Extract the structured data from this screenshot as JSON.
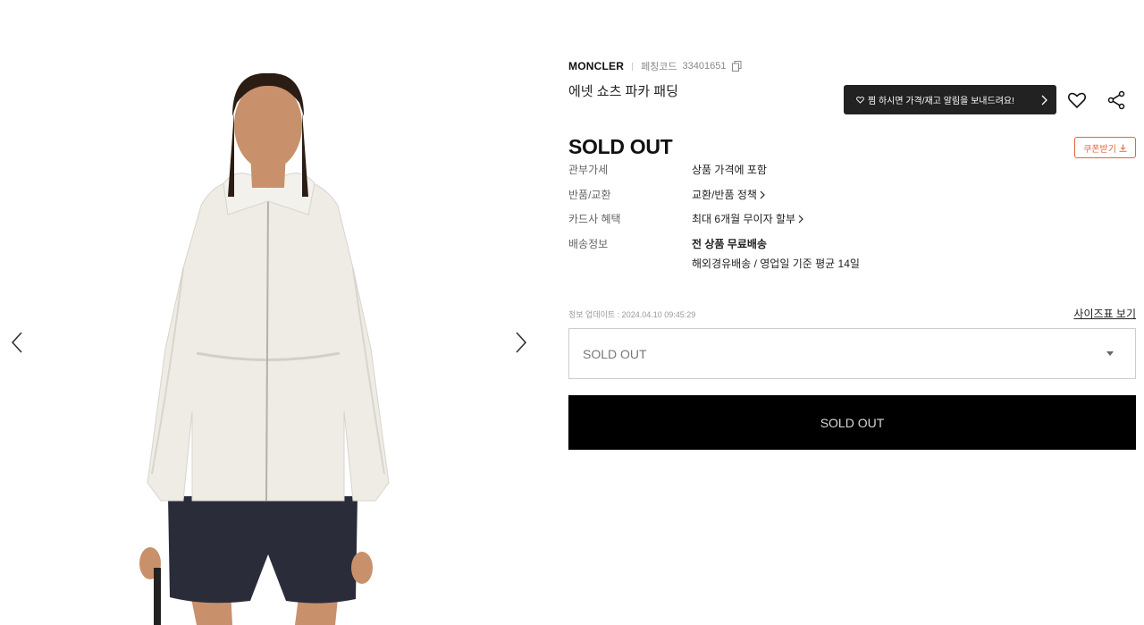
{
  "gallery": {
    "prev_icon": "chevron-left-icon",
    "next_icon": "chevron-right-icon"
  },
  "product": {
    "brand": "MONCLER",
    "code_label": "페칭코드",
    "code_value": "33401651",
    "name": "에넷 쇼츠 파카 패딩",
    "status_title": "SOLD OUT"
  },
  "alert": {
    "text": "찜 하시면 가격/재고 알림을 보내드려요!"
  },
  "coupon": {
    "label": "쿠폰받기"
  },
  "specs": [
    {
      "label": "관부가세",
      "value": "상품 가격에 포함",
      "chevron": false
    },
    {
      "label": "반품/교환",
      "value": "교환/반품 정책",
      "chevron": true
    },
    {
      "label": "카드사 혜택",
      "value": "최대 6개월 무이자 할부",
      "chevron": true
    },
    {
      "label": "배송정보",
      "value": "전 상품 무료배송",
      "chevron": false,
      "sub": "해외경유배송 / 영업일 기준 평균 14일"
    }
  ],
  "update": {
    "text": "정보 업데이트 : 2024.04.10 09:45:29"
  },
  "size_link": "사이즈표 보기",
  "option_select": {
    "selected": "SOLD OUT"
  },
  "buy_button": {
    "label": "SOLD OUT"
  },
  "colors": {
    "accent": "#e8623c",
    "dark": "#222222",
    "button_bg": "#000000"
  }
}
